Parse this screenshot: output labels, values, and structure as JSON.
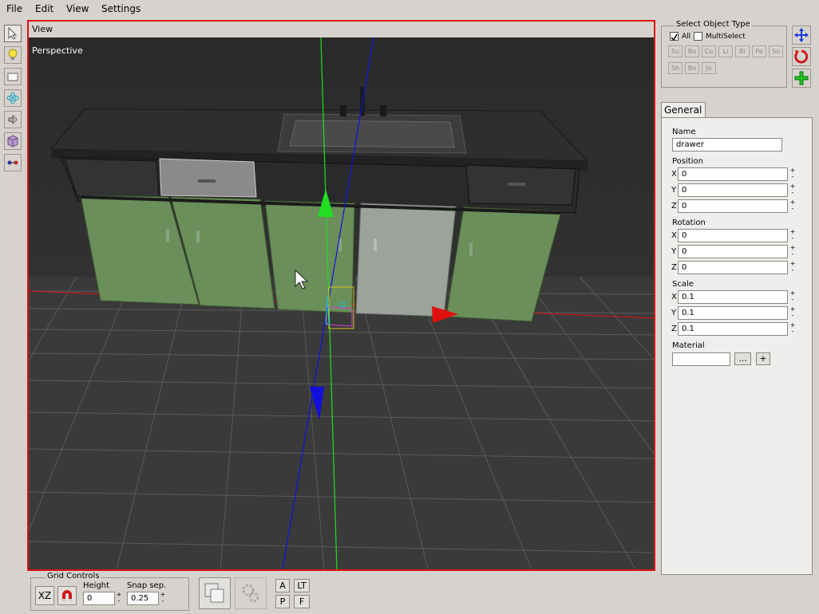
{
  "menu": {
    "file": "File",
    "edit": "Edit",
    "view": "View",
    "settings": "Settings"
  },
  "view": {
    "header": "View",
    "camera_label": "Perspective"
  },
  "select_object_type": {
    "title": "Select Object Type",
    "all_label": "All",
    "multiselect_label": "MultiSelect",
    "type_buttons": [
      "Su",
      "Bo",
      "Co",
      "Li",
      "Bi",
      "Pa",
      "So",
      "Sh",
      "Bo",
      "Jo"
    ]
  },
  "tabs": {
    "general": "General"
  },
  "properties": {
    "name_label": "Name",
    "name_value": "drawer",
    "position_label": "Position",
    "position": {
      "x": "0",
      "y": "0",
      "z": "0"
    },
    "rotation_label": "Rotation",
    "rotation": {
      "x": "0",
      "y": "0",
      "z": "0"
    },
    "scale_label": "Scale",
    "scale": {
      "x": "0.1",
      "y": "0.1",
      "z": "0.1"
    },
    "material_label": "Material",
    "material_value": "",
    "browse_label": "...",
    "add_label": "+"
  },
  "axis_labels": {
    "x": "X",
    "y": "Y",
    "z": "Z"
  },
  "spin": {
    "up": "+",
    "down": "-"
  },
  "grid_controls": {
    "title": "Grid Controls",
    "plane_label": "XZ",
    "height_label": "Height",
    "height_value": "0",
    "snap_label": "Snap sep.",
    "snap_value": "0.25"
  },
  "view_buttons": {
    "a": "A",
    "lt": "LT",
    "p": "P",
    "f": "F"
  },
  "colors": {
    "viewport_border": "#e01010",
    "x_axis": "#e01010",
    "y_axis": "#22dd22",
    "z_axis": "#1010dd",
    "cabinet_green": "#6a8f5a"
  }
}
